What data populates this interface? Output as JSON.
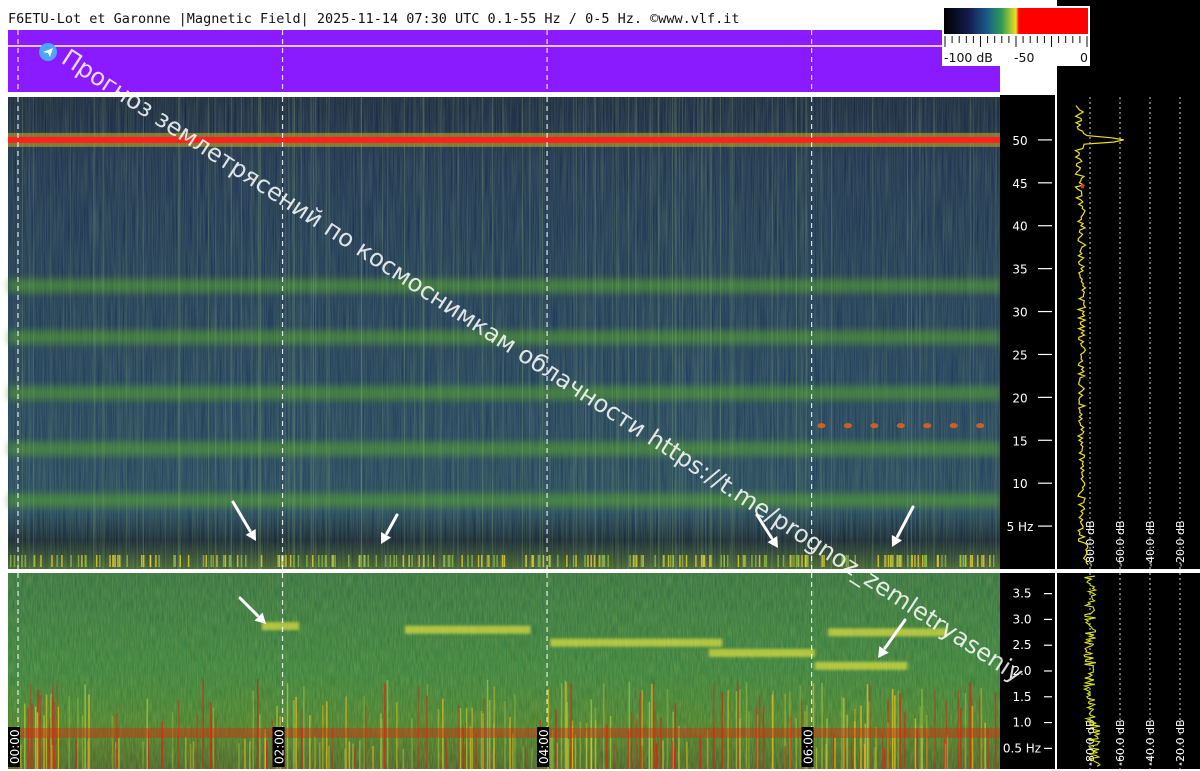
{
  "header": {
    "title": "F6ETU-Lot et Garonne |Magnetic Field| 2025-11-14 07:30 UTC 0.1-55 Hz / 0-5 Hz. ©www.vlf.it"
  },
  "colorbar": {
    "labels": [
      "-100 dB",
      "-50",
      "0"
    ]
  },
  "watermark": {
    "text": "Прогноз землетрясений по космоснимкам облачности  https://t.me/prognoz_zemletryaseniy"
  },
  "chart_data": [
    {
      "type": "heatmap",
      "panel": "upper",
      "y_ticks": [
        "5 Hz",
        "10",
        "15",
        "20",
        "25",
        "30",
        "35",
        "40",
        "45",
        "50"
      ],
      "y_values": [
        5,
        10,
        15,
        20,
        25,
        30,
        35,
        40,
        45,
        50
      ],
      "ylim": [
        0,
        55
      ],
      "bands_hz": [
        {
          "f": 50,
          "level": "red"
        },
        {
          "f": 8,
          "level": "green"
        },
        {
          "f": 14,
          "level": "green"
        },
        {
          "f": 20.5,
          "level": "green"
        },
        {
          "f": 27,
          "level": "green"
        },
        {
          "f": 33,
          "level": "green"
        }
      ],
      "grid": true
    },
    {
      "type": "heatmap",
      "panel": "lower",
      "y_ticks": [
        "0.5 Hz",
        "1.0",
        "1.5",
        "2.0",
        "2.5",
        "3.0",
        "3.5"
      ],
      "y_values": [
        0.5,
        1.0,
        1.5,
        2.0,
        2.5,
        3.0,
        3.5
      ],
      "ylim": [
        0.1,
        3.9
      ],
      "x_ticks": [
        "00:00",
        "02:00",
        "04:00",
        "06:00"
      ],
      "x_values_hours": [
        0,
        2,
        4,
        6
      ],
      "xlim_hours": [
        0,
        7.5
      ],
      "grid": true
    },
    {
      "type": "line",
      "panel": "spectrum-upper",
      "x_ticks": [
        "-80.0 dB",
        "-60.0 dB",
        "-40.0 dB",
        "-20.0 dB"
      ],
      "x_values": [
        -80,
        -60,
        -40,
        -20
      ],
      "xlim": [
        -100,
        -10
      ],
      "ylim": [
        0,
        55
      ],
      "peak": {
        "f": 50,
        "db": -58
      }
    },
    {
      "type": "line",
      "panel": "spectrum-lower",
      "x_ticks": [
        "-80.0 dB",
        "-60.0 dB",
        "-40.0 dB",
        "-20.0 dB"
      ],
      "x_values": [
        -80,
        -60,
        -40,
        -20
      ],
      "xlim": [
        -100,
        -10
      ],
      "ylim": [
        0.1,
        3.9
      ]
    }
  ],
  "colors": {
    "purple_header": "#8a1aff",
    "noise_low": "#12244a",
    "band_green": "#5aa632",
    "line_red": "#ff2020",
    "arrow": "#ffffff"
  }
}
